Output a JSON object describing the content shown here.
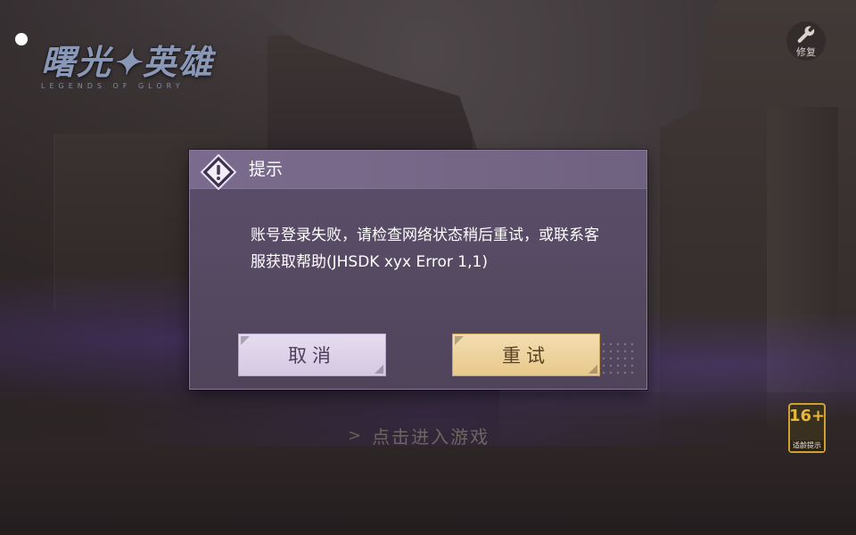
{
  "logo": {
    "title": "曙光✦英雄",
    "subtitle": "LEGENDS OF GLORY"
  },
  "top_right": {
    "repair_label": "修复",
    "icon": "wrench-icon"
  },
  "dialog": {
    "title": "提示",
    "icon": "warning-diamond-icon",
    "message": "账号登录失败，请检查网络状态稍后重试，或联系客服获取帮助(JHSDK xyx Error 1,1)",
    "cancel_label": "取消",
    "retry_label": "重试"
  },
  "enter_hint": {
    "text": "点击进入游戏",
    "icon": "chevron-right-icon"
  },
  "age_badge": {
    "rating": "16+",
    "label": "适龄提示"
  },
  "colors": {
    "dialog_bg": "#564a63",
    "dialog_header": "#7a6b8e",
    "cancel_button": "#ddd1e8",
    "retry_button": "#eed3a0",
    "age_badge_accent": "#e8b838"
  }
}
